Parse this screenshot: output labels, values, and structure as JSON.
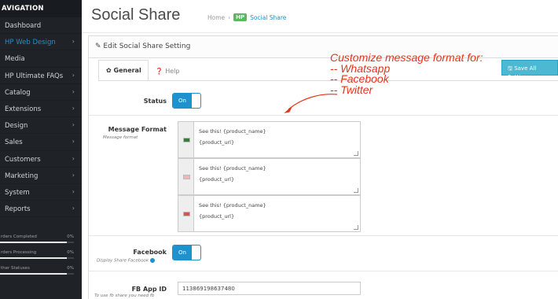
{
  "sidebar": {
    "heading": "AVIGATION",
    "items": [
      {
        "label": "Dashboard",
        "chev": ""
      },
      {
        "label": "HP Web Design",
        "chev": "›"
      },
      {
        "label": "Media",
        "chev": ""
      },
      {
        "label": "HP Ultimate FAQs",
        "chev": "›"
      },
      {
        "label": "Catalog",
        "chev": "›"
      },
      {
        "label": "Extensions",
        "chev": "›"
      },
      {
        "label": "Design",
        "chev": "›"
      },
      {
        "label": "Sales",
        "chev": "›"
      },
      {
        "label": "Customers",
        "chev": "›"
      },
      {
        "label": "Marketing",
        "chev": "›"
      },
      {
        "label": "System",
        "chev": "›"
      },
      {
        "label": "Reports",
        "chev": "›"
      }
    ],
    "stats": [
      {
        "label": "rders Completed",
        "value": "0%"
      },
      {
        "label": "rders Processing",
        "value": "0%"
      },
      {
        "label": "ther Statuses",
        "value": "0%"
      }
    ]
  },
  "header": {
    "title": "Social Share",
    "crumb_home": "Home",
    "crumb_sep": "›",
    "crumb_badge": "HP",
    "crumb_current": "Social Share"
  },
  "panel": {
    "heading": "Edit Social Share Setting",
    "tab_general": "General",
    "tab_help": "Help",
    "save_label": "Save All Settings"
  },
  "form": {
    "status_label": "Status",
    "status_toggle": "On",
    "message_label": "Message Format",
    "message_sub": "Message format",
    "formats": [
      {
        "line1": "See this! {product_name}",
        "line2": "{product_url}",
        "color": "#3a7d3a"
      },
      {
        "line1": "See this! {product_name}",
        "line2": "{product_url}",
        "color": "#d9534f"
      },
      {
        "line1": "See this! {product_name}",
        "line2": "{product_url}",
        "color": "#d9534f"
      }
    ],
    "facebook_label": "Facebook",
    "facebook_sub": "Display Share Facebook",
    "facebook_toggle": "On",
    "fbapp_label": "FB App ID",
    "fbapp_sub": "To use fb share you need fb",
    "fbapp_value": "113869198637480"
  },
  "callout": {
    "text": "Customize message format for:\n-- Whatsapp\n-- Facebook\n-- Twitter",
    "color": "#e8331a"
  }
}
